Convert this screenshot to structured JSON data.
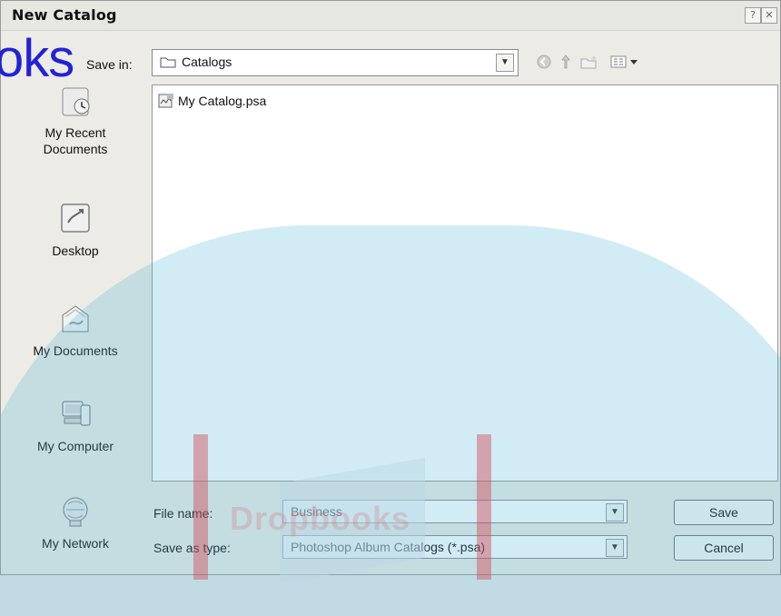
{
  "window": {
    "title": "New Catalog"
  },
  "save_in": {
    "label": "Save in:",
    "value": "Catalogs"
  },
  "places": [
    {
      "label": "My Recent\nDocuments",
      "icon": "recent-documents-icon"
    },
    {
      "label": "Desktop",
      "icon": "desktop-icon"
    },
    {
      "label": "My Documents",
      "icon": "my-documents-icon"
    },
    {
      "label": "My Computer",
      "icon": "my-computer-icon"
    },
    {
      "label": "My Network",
      "icon": "my-network-icon"
    }
  ],
  "files": [
    {
      "name": "My Catalog.psa"
    }
  ],
  "file_name": {
    "label": "File name:",
    "value": "Business"
  },
  "save_as_type": {
    "label": "Save as type:",
    "value": "Photoshop Album Catalogs (*.psa)"
  },
  "buttons": {
    "save": "Save",
    "cancel": "Cancel"
  },
  "watermark": {
    "text": "oks",
    "faint_text": "Dropbooks"
  }
}
